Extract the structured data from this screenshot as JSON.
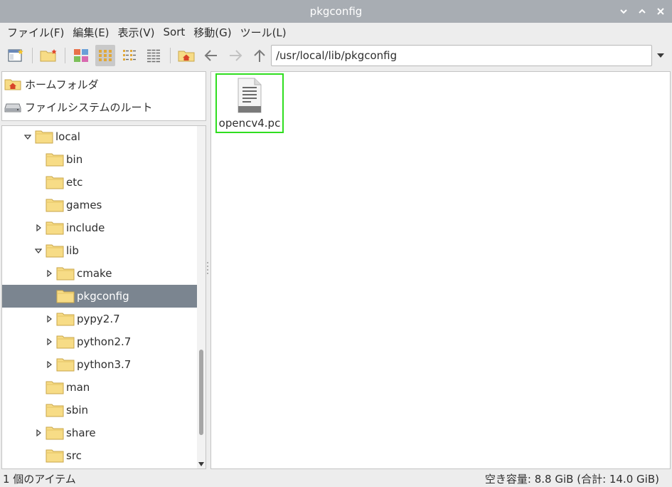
{
  "window": {
    "title": "pkgconfig"
  },
  "menu": [
    {
      "label": "ファイル(F)"
    },
    {
      "label": "編集(E)"
    },
    {
      "label": "表示(V)"
    },
    {
      "label": "Sort"
    },
    {
      "label": "移動(G)"
    },
    {
      "label": "ツール(L)"
    }
  ],
  "toolbar": {
    "path": "/usr/local/lib/pkgconfig",
    "active_view": "icon-view",
    "icons": [
      "new-window-icon",
      "new-folder-icon",
      "thumbnail-view-icon",
      "icon-view-icon",
      "compact-view-icon",
      "list-view-icon",
      "home-icon",
      "back-arrow-icon",
      "forward-arrow-icon",
      "up-arrow-icon",
      "chevron-down-icon"
    ]
  },
  "places": [
    {
      "label": "ホームフォルダ",
      "icon": "home-icon"
    },
    {
      "label": "ファイルシステムのルート",
      "icon": "drive-icon"
    }
  ],
  "tree": [
    {
      "label": "local",
      "expander": "expanded",
      "depth": 0
    },
    {
      "label": "bin",
      "expander": "none",
      "depth": 1
    },
    {
      "label": "etc",
      "expander": "none",
      "depth": 1
    },
    {
      "label": "games",
      "expander": "none",
      "depth": 1
    },
    {
      "label": "include",
      "expander": "collapsed",
      "depth": 1
    },
    {
      "label": "lib",
      "expander": "expanded",
      "depth": 1
    },
    {
      "label": "cmake",
      "expander": "collapsed",
      "depth": 2
    },
    {
      "label": "pkgconfig",
      "expander": "none",
      "depth": 2,
      "selected": true
    },
    {
      "label": "pypy2.7",
      "expander": "collapsed",
      "depth": 2
    },
    {
      "label": "python2.7",
      "expander": "collapsed",
      "depth": 2
    },
    {
      "label": "python3.7",
      "expander": "collapsed",
      "depth": 2
    },
    {
      "label": "man",
      "expander": "none",
      "depth": 1
    },
    {
      "label": "sbin",
      "expander": "none",
      "depth": 1
    },
    {
      "label": "share",
      "expander": "collapsed",
      "depth": 1
    },
    {
      "label": "src",
      "expander": "none",
      "depth": 1
    }
  ],
  "files": [
    {
      "name": "opencv4.pc",
      "icon": "text-file-icon",
      "highlighted": true
    }
  ],
  "status": {
    "left": "1 個のアイテム",
    "right": "空き容量: 8.8 GiB (合計: 14.0 GiB)"
  },
  "colors": {
    "titlebar": "#a8adb3",
    "selection": "#7b8590",
    "highlight_border": "#2fde1f",
    "folder": "#f7dc86"
  }
}
